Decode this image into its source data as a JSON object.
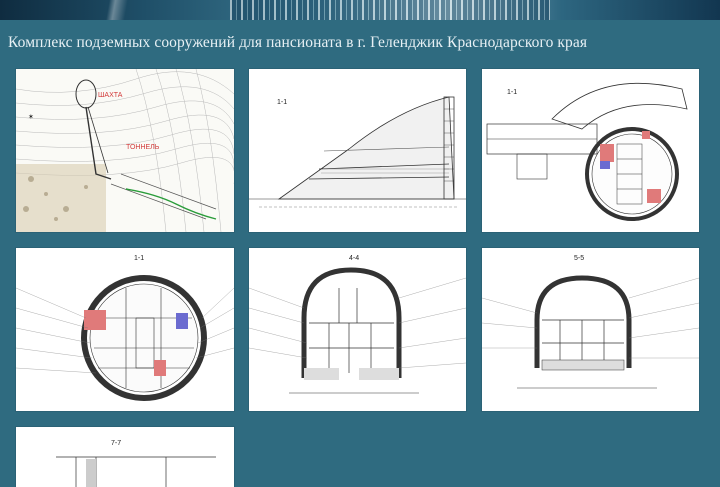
{
  "page": {
    "title": "Комплекс подземных сооружений для пансионата в г. Геленджик Краснодарского края"
  },
  "drawings": [
    {
      "name": "site-plan",
      "label": ""
    },
    {
      "name": "section-1-1",
      "label": "1-1"
    },
    {
      "name": "plan-view",
      "label": "1-1"
    },
    {
      "name": "circular-section",
      "label": "1-1"
    },
    {
      "name": "arch-section-a",
      "label": "4-4"
    },
    {
      "name": "arch-section-b",
      "label": "5-5"
    },
    {
      "name": "section-7-7",
      "label": "7-7"
    }
  ],
  "colors": {
    "background": "#2f6b80",
    "title_text": "#e7f0f4",
    "thumbnail_bg": "#ffffff",
    "accent_red": "#d23a3a",
    "accent_blue": "#6b6bd0"
  }
}
